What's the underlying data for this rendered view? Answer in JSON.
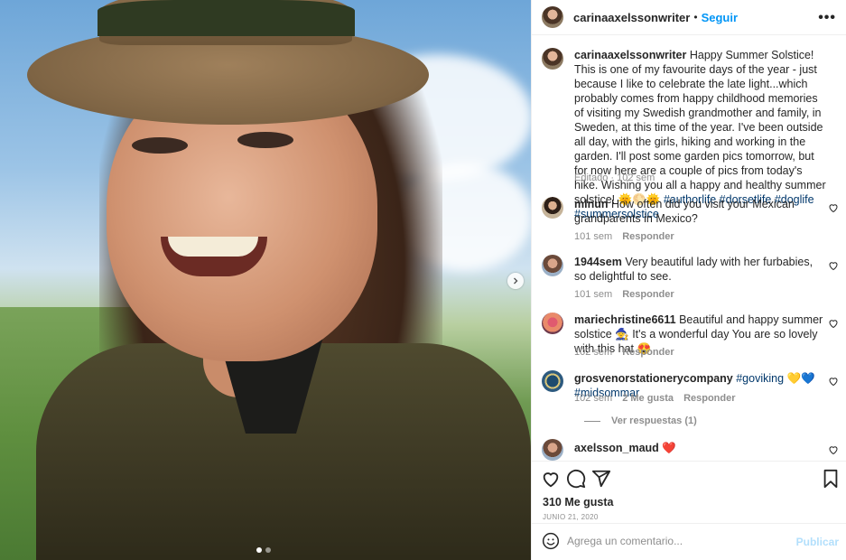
{
  "post": {
    "username": "carinaaxelssonwriter",
    "separator": "•",
    "follow_label": "Seguir",
    "more_label": "•••",
    "caption": "Happy Summer Solstice! This is one of my favourite days of the year - just because I like to celebrate the late light...which probably comes from happy childhood memories of visiting my Swedish grandmother and family, in Sweden, at this time of the year. I've been outside all day, with the girls, hiking and working in the garden. I'll post some garden pics tomorrow, but for now here are a couple of pics from today's hike. Wishing you all a happy and healthy summer solstice!",
    "caption_emoji": "🌞🌕🌞",
    "hashtags_line1": "#authorlife #dorsetlife #doglife",
    "hashtags_line2": "#summersolstice",
    "caption_meta": "Editado · 102 sem"
  },
  "comments": [
    {
      "username": "mlnun",
      "text": "How often did you visit your Mexican grandparents in Mexico?",
      "time": "101 sem",
      "reply_label": "Responder"
    },
    {
      "username": "1944sem",
      "text": "Very beautiful lady with her furbabies, so delightful to see.",
      "time": "101 sem",
      "reply_label": "Responder"
    },
    {
      "username": "mariechristine6611",
      "text": "Beautiful and happy summer solstice 🧙 It's a wonderful day You are so lovely with this hat 😍",
      "time": "102 sem",
      "reply_label": "Responder"
    },
    {
      "username": "grosvenorstationerycompany",
      "text": "#goviking 💛💙 #midsommar",
      "time": "102 sem",
      "likes": "2 Me gusta",
      "reply_label": "Responder",
      "view_replies": "Ver respuestas (1)"
    },
    {
      "username": "axelsson_maud",
      "text": "❤️"
    }
  ],
  "actions": {
    "likes": "310 Me gusta",
    "date": "JUNIO 21, 2020"
  },
  "composer": {
    "placeholder": "Agrega un comentario...",
    "publish_label": "Publicar"
  },
  "colors": {
    "accent": "#0095f6",
    "hashtag": "#00376b",
    "muted": "#8e8e8e"
  },
  "icons": [
    "chevron-right-icon",
    "heart-icon",
    "comment-icon",
    "share-icon",
    "bookmark-icon",
    "emoji-icon",
    "more-icon"
  ]
}
